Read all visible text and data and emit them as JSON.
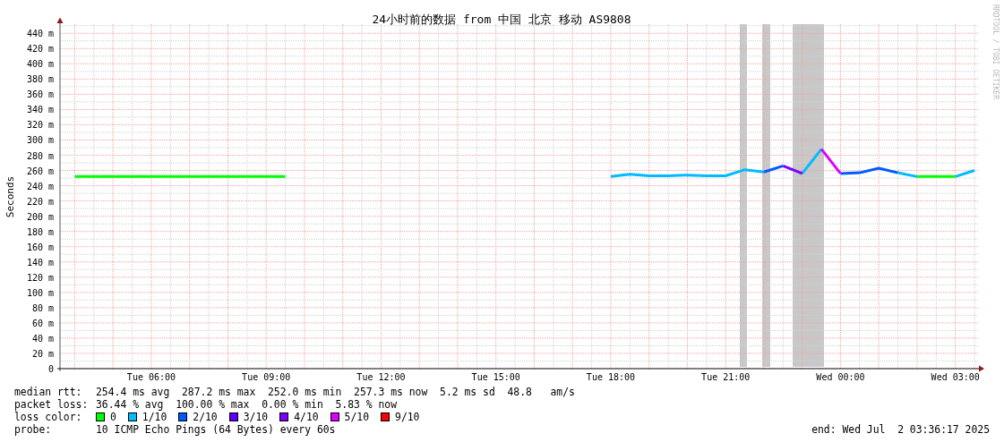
{
  "chart": {
    "chart_data": {
      "type": "line",
      "title": "24小时前的数据 from 中国 北京 移动 AS9808",
      "ylabel": "Seconds",
      "categories": [
        null,
        null,
        null,
        null,
        "Tue 06:00",
        null,
        null,
        null,
        null,
        null,
        "Tue 09:00",
        null,
        null,
        null,
        null,
        null,
        "Tue 12:00",
        null,
        null,
        null,
        null,
        null,
        "Tue 15:00",
        null,
        null,
        null,
        null,
        null,
        "Tue 18:00",
        null,
        null,
        null,
        null,
        null,
        "Tue 21:00",
        null,
        null,
        null,
        null,
        null,
        "Wed 00:00",
        null,
        null,
        null,
        null,
        null,
        "Wed 03:00",
        null
      ],
      "series": [
        {
          "name": "0",
          "color": "#00ff00",
          "values": [
            252,
            252,
            252,
            252,
            252,
            252,
            252,
            252,
            252,
            252,
            252,
            252,
            null,
            null,
            null,
            null,
            null,
            null,
            null,
            null,
            null,
            null,
            null,
            null,
            null,
            null,
            null,
            null,
            null,
            null,
            null,
            null,
            null,
            null,
            null,
            null,
            null,
            null,
            null,
            null,
            null,
            null,
            null,
            null,
            252,
            252,
            252,
            null
          ]
        },
        {
          "name": "1/10",
          "color": "#00bbff",
          "values": [
            null,
            null,
            null,
            null,
            null,
            null,
            null,
            null,
            null,
            null,
            null,
            null,
            null,
            null,
            null,
            null,
            null,
            null,
            null,
            null,
            null,
            null,
            null,
            null,
            null,
            null,
            null,
            null,
            252,
            255,
            253,
            253,
            254,
            253,
            253,
            261,
            258,
            null,
            256,
            288,
            null,
            null,
            null,
            257,
            252,
            null,
            252,
            260
          ]
        },
        {
          "name": "2/10",
          "color": "#0059ff",
          "values": [
            null,
            null,
            null,
            null,
            null,
            null,
            null,
            null,
            null,
            null,
            null,
            null,
            null,
            null,
            null,
            null,
            null,
            null,
            null,
            null,
            null,
            null,
            null,
            null,
            null,
            null,
            null,
            null,
            null,
            null,
            null,
            null,
            null,
            null,
            null,
            null,
            258,
            266,
            null,
            null,
            256,
            257,
            263,
            257,
            null,
            null,
            null,
            null
          ]
        },
        {
          "name": "3/10",
          "color": "#5e00ff",
          "values": [
            null,
            null,
            null,
            null,
            null,
            null,
            null,
            null,
            null,
            null,
            null,
            null,
            null,
            null,
            null,
            null,
            null,
            null,
            null,
            null,
            null,
            null,
            null,
            null,
            null,
            null,
            null,
            null,
            null,
            null,
            null,
            null,
            null,
            null,
            null,
            null,
            null,
            null,
            null,
            null,
            null,
            null,
            null,
            null,
            null,
            null,
            null,
            null
          ]
        },
        {
          "name": "4/10",
          "color": "#7e00ff",
          "values": [
            null,
            null,
            null,
            null,
            null,
            null,
            null,
            null,
            null,
            null,
            null,
            null,
            null,
            null,
            null,
            null,
            null,
            null,
            null,
            null,
            null,
            null,
            null,
            null,
            null,
            null,
            null,
            null,
            null,
            null,
            null,
            null,
            null,
            null,
            null,
            null,
            null,
            266,
            256,
            null,
            null,
            null,
            null,
            null,
            null,
            null,
            null,
            null
          ]
        },
        {
          "name": "5/10",
          "color": "#dd00ff",
          "values": [
            null,
            null,
            null,
            null,
            null,
            null,
            null,
            null,
            null,
            null,
            null,
            null,
            null,
            null,
            null,
            null,
            null,
            null,
            null,
            null,
            null,
            null,
            null,
            null,
            null,
            null,
            null,
            null,
            null,
            null,
            null,
            null,
            null,
            null,
            null,
            null,
            null,
            null,
            null,
            288,
            256,
            null,
            null,
            null,
            null,
            null,
            null,
            null
          ]
        },
        {
          "name": "9/10",
          "color": "#ff0000",
          "values": [
            null,
            null,
            null,
            null,
            null,
            null,
            null,
            null,
            null,
            null,
            null,
            null,
            null,
            null,
            null,
            null,
            null,
            null,
            null,
            null,
            null,
            null,
            null,
            null,
            null,
            null,
            null,
            null,
            null,
            null,
            null,
            null,
            null,
            null,
            null,
            null,
            null,
            null,
            null,
            null,
            null,
            null,
            null,
            null,
            null,
            null,
            null,
            null
          ]
        }
      ],
      "ylim": [
        0,
        452
      ],
      "grid": true,
      "yticks": [
        {
          "value": 0,
          "label": "0"
        },
        {
          "value": 20,
          "label": "20 m"
        },
        {
          "value": 40,
          "label": "40 m"
        },
        {
          "value": 60,
          "label": "60 m"
        },
        {
          "value": 80,
          "label": "80 m"
        },
        {
          "value": 100,
          "label": "100 m"
        },
        {
          "value": 120,
          "label": "120 m"
        },
        {
          "value": 140,
          "label": "140 m"
        },
        {
          "value": 160,
          "label": "160 m"
        },
        {
          "value": 180,
          "label": "180 m"
        },
        {
          "value": 200,
          "label": "200 m"
        },
        {
          "value": 220,
          "label": "220 m"
        },
        {
          "value": 240,
          "label": "240 m"
        },
        {
          "value": 260,
          "label": "260 m"
        },
        {
          "value": 280,
          "label": "280 m"
        },
        {
          "value": 300,
          "label": "300 m"
        },
        {
          "value": 320,
          "label": "320 m"
        },
        {
          "value": 340,
          "label": "340 m"
        },
        {
          "value": 360,
          "label": "360 m"
        },
        {
          "value": 380,
          "label": "380 m"
        },
        {
          "value": 400,
          "label": "400 m"
        },
        {
          "value": 420,
          "label": "420 m"
        },
        {
          "value": 440,
          "label": "440 m"
        }
      ]
    }
  },
  "credit": "RRDTOOL / TOBI OETIKER",
  "stats": [
    {
      "label": "median rtt:",
      "value": "254.4 ms avg  287.2 ms max  252.0 ms min  257.3 ms now  5.2 ms sd  48.8   am/s"
    },
    {
      "label": "packet loss:",
      "value": "36.44 % avg  100.00 % max  0.00 % min  5.83 % now"
    }
  ],
  "loss_legend": {
    "label": "loss color:"
  },
  "probe": {
    "label": "probe:",
    "value": "10 ICMP Echo Pings (64 Bytes) every 60s"
  },
  "end": "end: Wed Jul  2 03:36:17 2025"
}
